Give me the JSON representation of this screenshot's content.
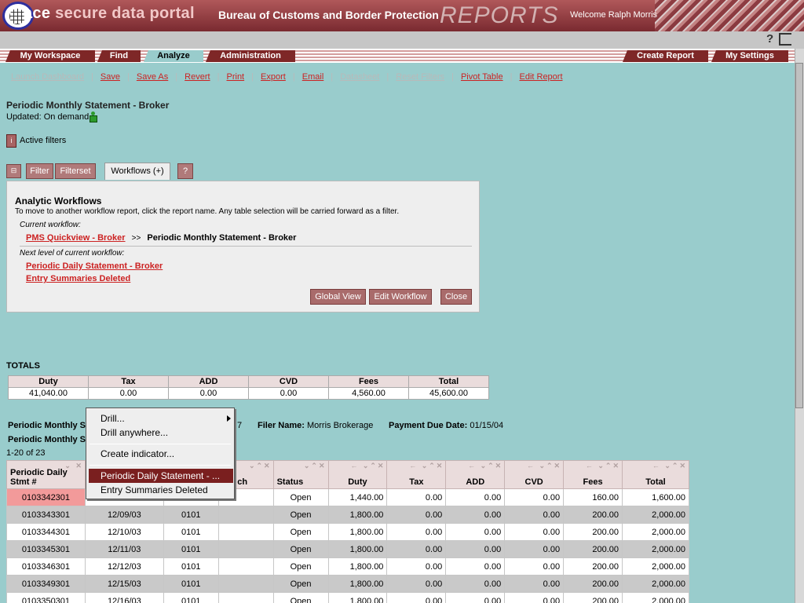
{
  "header": {
    "app_name_1": "ace",
    "app_name_2": "secure data portal",
    "agency": "Bureau of Customs and Border Protection",
    "section": "REPORTS",
    "welcome": "Welcome Ralph Morris"
  },
  "nav": {
    "tabs": [
      {
        "label": "My Workspace"
      },
      {
        "label": "Find"
      },
      {
        "label": "Analyze",
        "active": true
      },
      {
        "label": "Administration"
      },
      {
        "label": "Create Report"
      },
      {
        "label": "My Settings"
      }
    ]
  },
  "toolbar": {
    "items": [
      {
        "label": "Launch Dashboard",
        "enabled": false
      },
      {
        "label": "Save",
        "enabled": true
      },
      {
        "label": "Save As",
        "enabled": true
      },
      {
        "label": "Revert",
        "enabled": true
      },
      {
        "label": "Print",
        "enabled": true
      },
      {
        "label": "Export",
        "enabled": true
      },
      {
        "label": "Email",
        "enabled": true
      },
      {
        "label": "Datasheet",
        "enabled": false
      },
      {
        "label": "Reset Filters",
        "enabled": false
      },
      {
        "label": "Pivot Table",
        "enabled": true
      },
      {
        "label": "Edit Report",
        "enabled": true
      }
    ]
  },
  "page": {
    "title": "Periodic Monthly Statement - Broker",
    "updated": "Updated: On demand",
    "active_filters": "Active filters"
  },
  "tabs2": {
    "filter": "Filter",
    "filterset": "Filterset",
    "workflows": "Workflows (+)",
    "help": "?"
  },
  "workflow": {
    "title": "Analytic Workflows",
    "description": "To move to another workflow report, click the report name. Any table selection will be carried forward as a filter.",
    "current_label": "Current workflow:",
    "current_link": "PMS Quickview - Broker",
    "arrow": ">>",
    "current_report": "Periodic Monthly Statement - Broker",
    "next_label": "Next level of current workflow:",
    "next_links": [
      "Periodic Daily Statement - Broker",
      "Entry Summaries Deleted"
    ],
    "buttons": {
      "global": "Global View",
      "edit": "Edit Workflow",
      "close": "Close"
    }
  },
  "totals": {
    "label": "TOTALS",
    "headers": [
      "Duty",
      "Tax",
      "ADD",
      "CVD",
      "Fees",
      "Total"
    ],
    "values": [
      "41,040.00",
      "0.00",
      "0.00",
      "0.00",
      "4,560.00",
      "45,600.00"
    ]
  },
  "report_info": {
    "line1_prefix": "Periodic Monthly S",
    "line1_mid": "7",
    "filer_label": "Filer Name:",
    "filer_value": "Morris Brokerage",
    "due_label": "Payment Due Date:",
    "due_value": "01/15/04",
    "line2_prefix": "Periodic Monthly S",
    "range": "1-20 of 23"
  },
  "table": {
    "headers": [
      "Periodic Daily Stmt #",
      "",
      "",
      "ent ch",
      "Status",
      "Duty",
      "Tax",
      "ADD",
      "CVD",
      "Fees",
      "Total"
    ],
    "rows": [
      [
        "0103342301",
        "",
        "",
        "",
        "Open",
        "1,440.00",
        "0.00",
        "0.00",
        "0.00",
        "160.00",
        "1,600.00"
      ],
      [
        "0103343301",
        "12/09/03",
        "0101",
        "",
        "Open",
        "1,800.00",
        "0.00",
        "0.00",
        "0.00",
        "200.00",
        "2,000.00"
      ],
      [
        "0103344301",
        "12/10/03",
        "0101",
        "",
        "Open",
        "1,800.00",
        "0.00",
        "0.00",
        "0.00",
        "200.00",
        "2,000.00"
      ],
      [
        "0103345301",
        "12/11/03",
        "0101",
        "",
        "Open",
        "1,800.00",
        "0.00",
        "0.00",
        "0.00",
        "200.00",
        "2,000.00"
      ],
      [
        "0103346301",
        "12/12/03",
        "0101",
        "",
        "Open",
        "1,800.00",
        "0.00",
        "0.00",
        "0.00",
        "200.00",
        "2,000.00"
      ],
      [
        "0103349301",
        "12/15/03",
        "0101",
        "",
        "Open",
        "1,800.00",
        "0.00",
        "0.00",
        "0.00",
        "200.00",
        "2,000.00"
      ],
      [
        "0103350301",
        "12/16/03",
        "0101",
        "",
        "Open",
        "1,800.00",
        "0.00",
        "0.00",
        "0.00",
        "200.00",
        "2,000.00"
      ]
    ]
  },
  "context_menu": {
    "drill": "Drill...",
    "drill_anywhere": "Drill anywhere...",
    "create_indicator": "Create indicator...",
    "item_hl": "Periodic Daily Statement - ...",
    "item_2": "Entry Summaries Deleted"
  },
  "colors": {
    "brand": "#7e2727",
    "link": "#cc2222",
    "background": "#99cccc"
  }
}
